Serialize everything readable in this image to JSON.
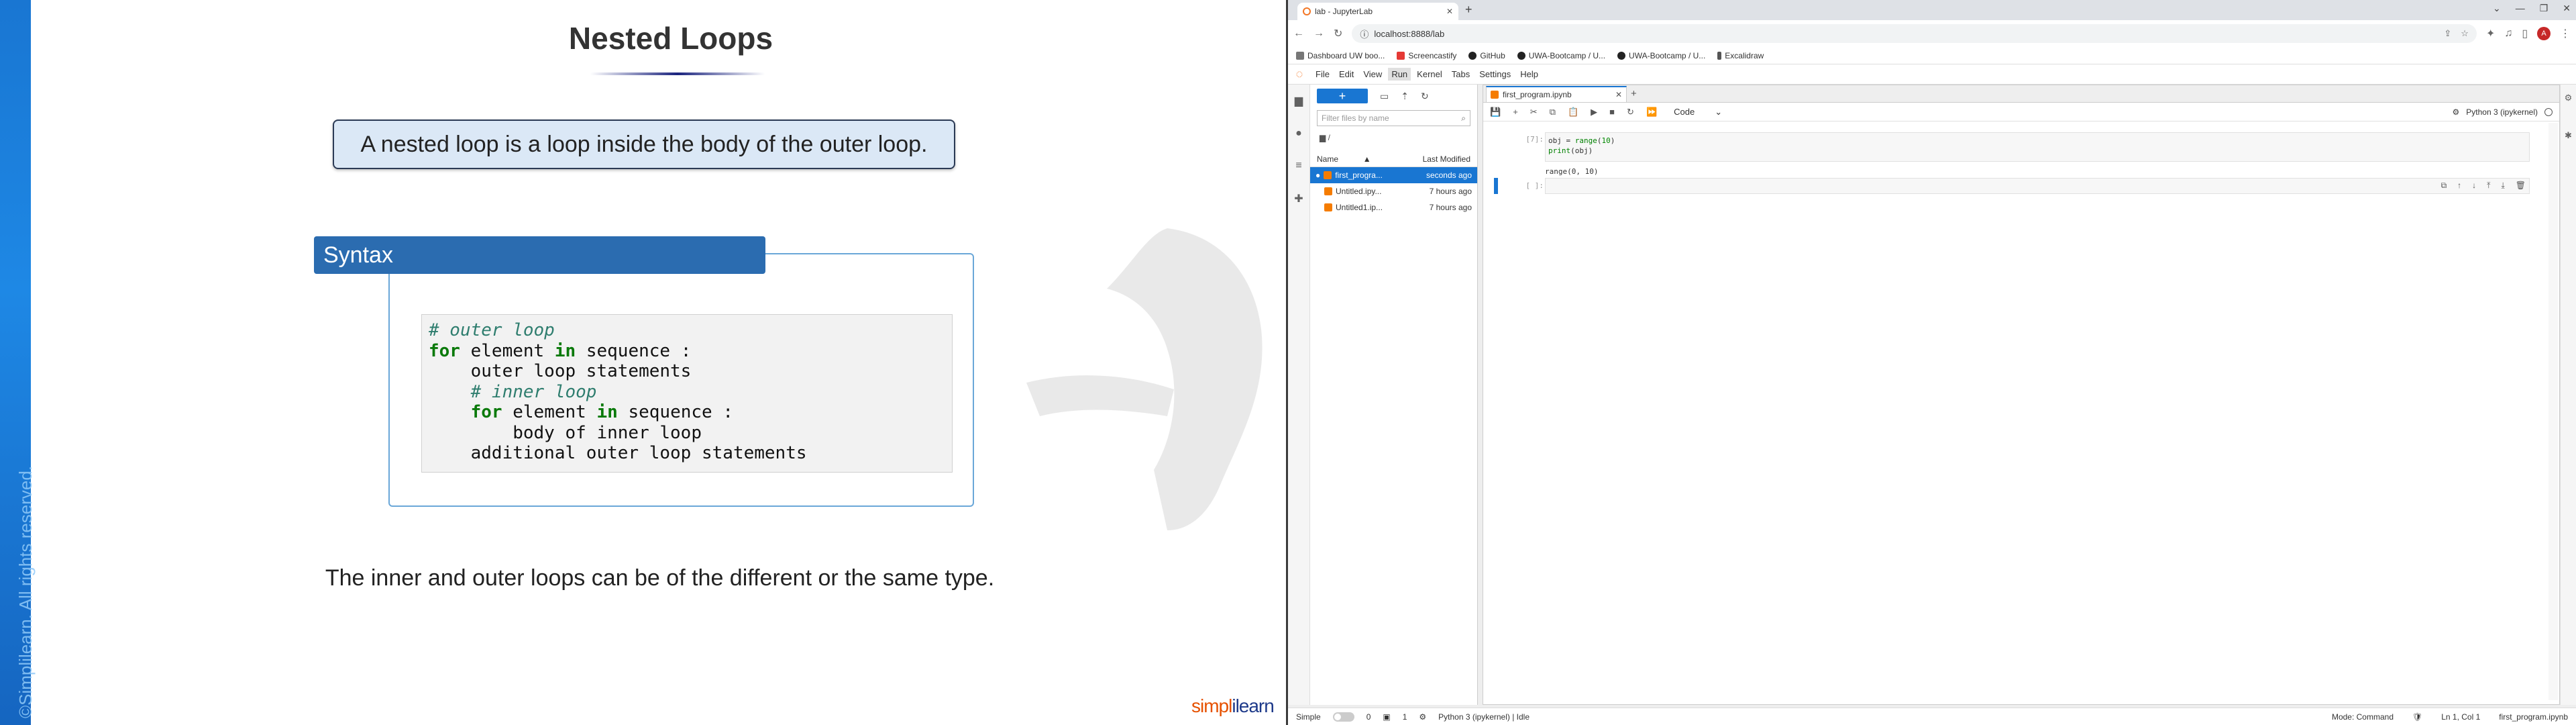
{
  "slide": {
    "title": "Nested Loops",
    "definition": "A nested loop is a loop inside the body of the outer loop.",
    "syntax_header": "Syntax",
    "code": {
      "l1_comment": "# outer loop",
      "l2_kw_for": "for",
      "l2_a": " element ",
      "l2_kw_in": "in",
      "l2_b": " sequence :",
      "l3": "    outer loop statements",
      "l4_comment": "# inner loop",
      "l5_kw_for": "for",
      "l5_a": " element ",
      "l5_kw_in": "in",
      "l5_b": " sequence :",
      "l6": "        body of inner loop",
      "l7": "    additional outer loop statements"
    },
    "footer_text": "The inner and outer loops can be of the different or the same type.",
    "copyright": "©Simplilearn. All rights reserved.",
    "brand_a": "simpl",
    "brand_b": "ilearn"
  },
  "browser": {
    "tab_title": "lab - JupyterLab",
    "url": "localhost:8888/lab",
    "avatar_letter": "A",
    "bookmarks": [
      "Dashboard UW boo...",
      "Screencastify",
      "GitHub",
      "UWA-Bootcamp / U...",
      "UWA-Bootcamp / U...",
      "Excalidraw"
    ],
    "menus": [
      "File",
      "Edit",
      "View",
      "Run",
      "Kernel",
      "Tabs",
      "Settings",
      "Help"
    ]
  },
  "filebrowser": {
    "filter_placeholder": "Filter files by name",
    "crumb": "/",
    "col_name": "Name",
    "col_modified": "Last Modified",
    "files": [
      {
        "name": "first_progra...",
        "modified": "seconds ago",
        "selected": true
      },
      {
        "name": "Untitled.ipy...",
        "modified": "7 hours ago",
        "selected": false
      },
      {
        "name": "Untitled1.ip...",
        "modified": "7 hours ago",
        "selected": false
      }
    ]
  },
  "notebook": {
    "tab_title": "first_program.ipynb",
    "cell_type": "Code",
    "kernel": "Python 3 (ipykernel)",
    "cell1_prompt": "[7]:",
    "cell1_l1_a": "obj = ",
    "cell1_l1_fn": "range",
    "cell1_l1_b": "(",
    "cell1_l1_num": "10",
    "cell1_l1_c": ")",
    "cell1_l2_fn": "print",
    "cell1_l2_b": "(obj)",
    "cell1_output": "range(0, 10)",
    "cell2_prompt": "[ ]:"
  },
  "status": {
    "mode_label": "Simple",
    "count_a": "0",
    "count_b": "1",
    "kernel_status": "Python 3 (ipykernel) | Idle",
    "mode": "Mode: Command",
    "position": "Ln 1, Col 1",
    "file": "first_program.ipynb"
  }
}
